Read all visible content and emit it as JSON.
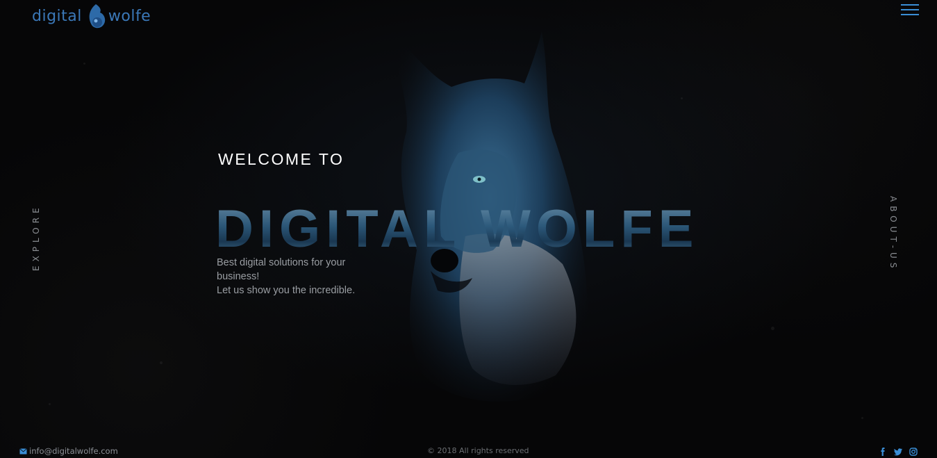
{
  "header": {
    "logo_left": "digital",
    "logo_right": "wolfe",
    "menu_icon": "hamburger-icon"
  },
  "side": {
    "explore": "EXPLORE",
    "about": "ABOUT-US"
  },
  "hero": {
    "welcome": "WELCOME TO",
    "title": "DIGITAL WOLFE",
    "tagline_line1": "Best digital solutions for your",
    "tagline_line2": "business!",
    "tagline_line3": "Let us show you the incredible."
  },
  "footer": {
    "email": "info@digitalwolfe.com",
    "email_icon": "envelope-icon",
    "copyright": "© 2018 All rights reserved",
    "social": [
      "facebook-icon",
      "twitter-icon",
      "instagram-icon"
    ]
  },
  "colors": {
    "accent": "#3a8ed6",
    "logo": "#3b78b8",
    "background": "#060607"
  }
}
